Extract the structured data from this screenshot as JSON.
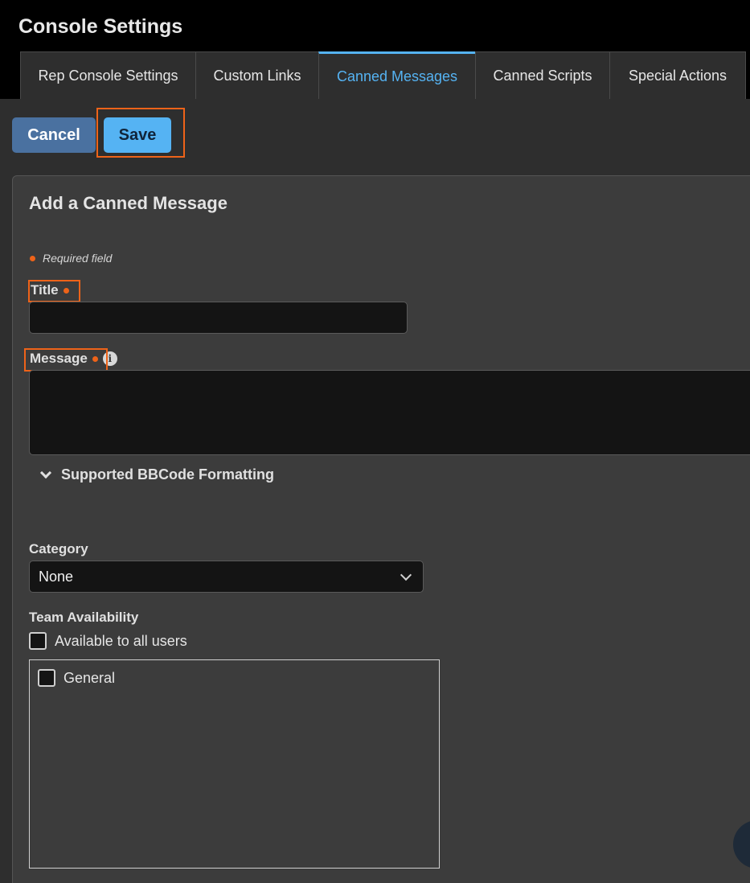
{
  "header": {
    "title": "Console Settings",
    "tabs": [
      {
        "label": "Rep Console Settings",
        "active": false
      },
      {
        "label": "Custom Links",
        "active": false
      },
      {
        "label": "Canned Messages",
        "active": true
      },
      {
        "label": "Canned Scripts",
        "active": false
      },
      {
        "label": "Special Actions",
        "active": false
      }
    ]
  },
  "toolbar": {
    "cancel_label": "Cancel",
    "save_label": "Save"
  },
  "form": {
    "title": "Add a Canned Message",
    "required_note": "Required field",
    "title_label": "Title",
    "title_value": "",
    "message_label": "Message",
    "message_value": "",
    "info_icon_glyph": "i",
    "bbcode_toggle_label": "Supported BBCode Formatting",
    "category_label": "Category",
    "category_selected": "None",
    "team_availability_label": "Team Availability",
    "all_users_label": "Available to all users",
    "teams": [
      {
        "label": "General",
        "checked": false
      }
    ]
  },
  "colors": {
    "accent": "#55b3f3",
    "cancel": "#4a71a0",
    "highlight": "#ee6319",
    "required_dot": "#ee6319"
  },
  "icons": [
    "info-icon",
    "chevron-down-icon",
    "select-chevron-icon",
    "chat-icon"
  ]
}
